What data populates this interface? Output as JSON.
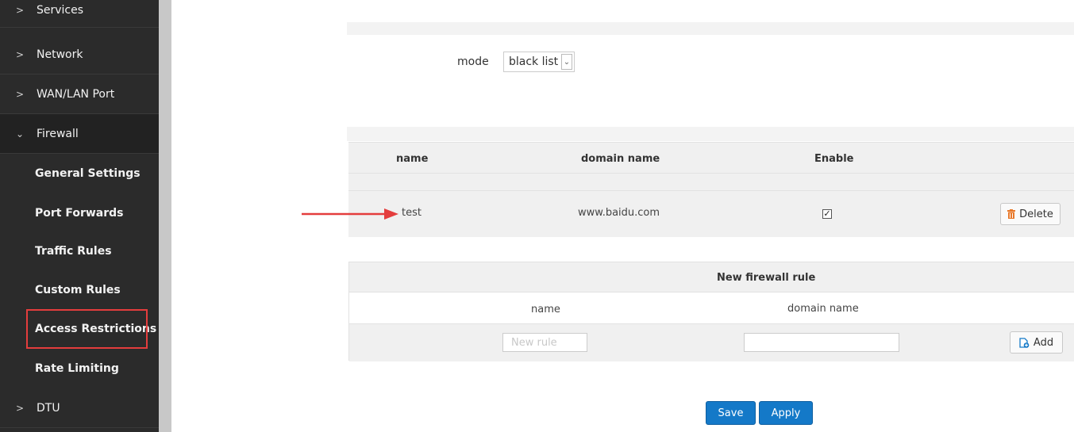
{
  "sidebar": {
    "items": [
      {
        "label": "Services",
        "kind": "top"
      },
      {
        "label": "Network",
        "kind": "top"
      },
      {
        "label": "WAN/LAN Port",
        "kind": "top"
      },
      {
        "label": "Firewall",
        "kind": "top-open"
      },
      {
        "label": "General Settings",
        "kind": "sub"
      },
      {
        "label": "Port Forwards",
        "kind": "sub"
      },
      {
        "label": "Traffic Rules",
        "kind": "sub"
      },
      {
        "label": "Custom Rules",
        "kind": "sub"
      },
      {
        "label": "Access Restrictions",
        "kind": "sub-active"
      },
      {
        "label": "Rate Limiting",
        "kind": "sub"
      },
      {
        "label": "DTU",
        "kind": "top"
      }
    ]
  },
  "mode": {
    "label": "mode",
    "value": "black list"
  },
  "rules_table": {
    "headers": {
      "name": "name",
      "domain": "domain name",
      "enable": "Enable"
    },
    "rows": [
      {
        "name": "test",
        "domain": "www.baidu.com",
        "enabled": true,
        "delete_label": "Delete"
      }
    ]
  },
  "new_rule": {
    "title": "New firewall rule",
    "name_header": "name",
    "domain_header": "domain name",
    "name_placeholder": "New rule",
    "domain_value": "",
    "add_label": "Add"
  },
  "actions": {
    "save": "Save",
    "apply": "Apply"
  },
  "colors": {
    "sidebar_bg": "#2b2b2b",
    "highlight": "#e43d3d",
    "primary": "#1479c8",
    "delete_icon": "#e8792b",
    "add_icon": "#1479c8"
  }
}
